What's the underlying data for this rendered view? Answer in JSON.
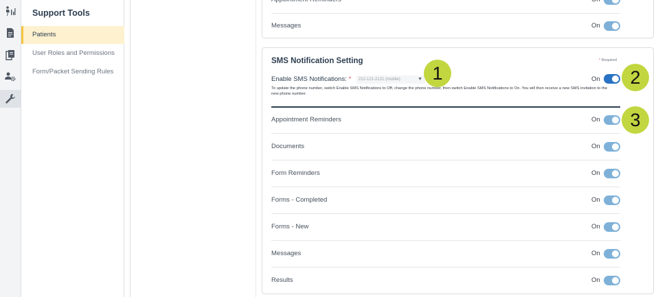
{
  "rail": {
    "icons": [
      "person-chart-icon",
      "document-icon",
      "copy-icon",
      "users-gear-icon",
      "wrench-icon"
    ]
  },
  "nav": {
    "title": "Support Tools",
    "items": [
      {
        "label": "Patients",
        "active": true
      },
      {
        "label": "User Roles and Permissions"
      },
      {
        "label": "Form/Packet Sending Rules"
      }
    ]
  },
  "top_card": {
    "rows": [
      {
        "label": "Appointment Reminders",
        "status": "On"
      },
      {
        "label": "Messages",
        "status": "On"
      }
    ]
  },
  "sms_card": {
    "title": "SMS Notification Setting",
    "required_label": "Required",
    "required_star": "*",
    "enable_label": "Enable SMS Notifications:",
    "enable_star": "*",
    "phone_value": "212-121-2121 (mobile)",
    "enable_status": "On",
    "help_text": "To update the phone number, switch Enable SMS Notifications to Off, change the phone number, then switch Enable SMS Notifications to On. You will then receive a new SMS invitation to the new phone number.",
    "rows": [
      {
        "label": "Appointment Reminders",
        "status": "On"
      },
      {
        "label": "Documents",
        "status": "On"
      },
      {
        "label": "Form Reminders",
        "status": "On"
      },
      {
        "label": "Forms - Completed",
        "status": "On"
      },
      {
        "label": "Forms - New",
        "status": "On"
      },
      {
        "label": "Messages",
        "status": "On"
      },
      {
        "label": "Results",
        "status": "On"
      }
    ]
  },
  "callouts": [
    "1",
    "2",
    "3"
  ],
  "colors": {
    "toggle_on": "#7fb1d8",
    "toggle_strong": "#2a73c4",
    "callout": "#c2d640",
    "nav_active": "#fdf1cf",
    "nav_active_border": "#f4c542"
  }
}
